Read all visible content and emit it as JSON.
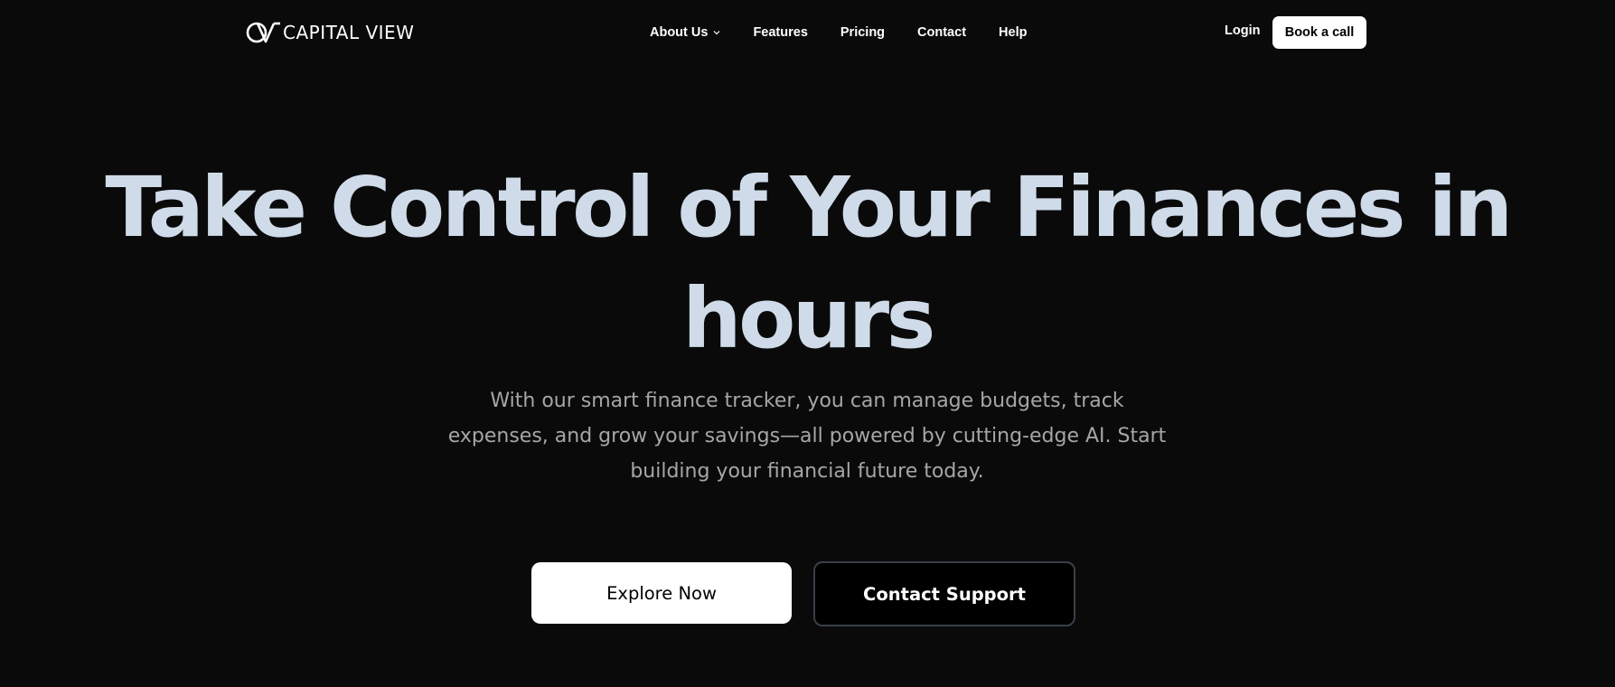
{
  "colors": {
    "background": "#0a0a0a",
    "headline": "#cfdbe8",
    "subtitle": "#a6a6a6",
    "primary_button_bg": "#ffffff",
    "secondary_button_bg": "#000000",
    "secondary_button_border": "#3a3f48"
  },
  "header": {
    "logo": {
      "icon": "cv-monogram-icon",
      "text": "CAPITAL VIEW"
    },
    "nav": [
      {
        "label": "About Us",
        "has_dropdown": true,
        "icon": "chevron-down-icon"
      },
      {
        "label": "Features"
      },
      {
        "label": "Pricing"
      },
      {
        "label": "Contact"
      },
      {
        "label": "Help"
      }
    ],
    "login_label": "Login",
    "book_call_label": "Book a call"
  },
  "hero": {
    "title_lines": [
      "Take Control of Your Finances in",
      "hours"
    ],
    "subtitle_lines": [
      "With our smart finance tracker, you can manage budgets, track",
      "expenses, and grow your savings—all powered by cutting-edge AI. Start",
      "building your financial future today."
    ],
    "primary_cta": "Explore Now",
    "secondary_cta": "Contact Support"
  }
}
